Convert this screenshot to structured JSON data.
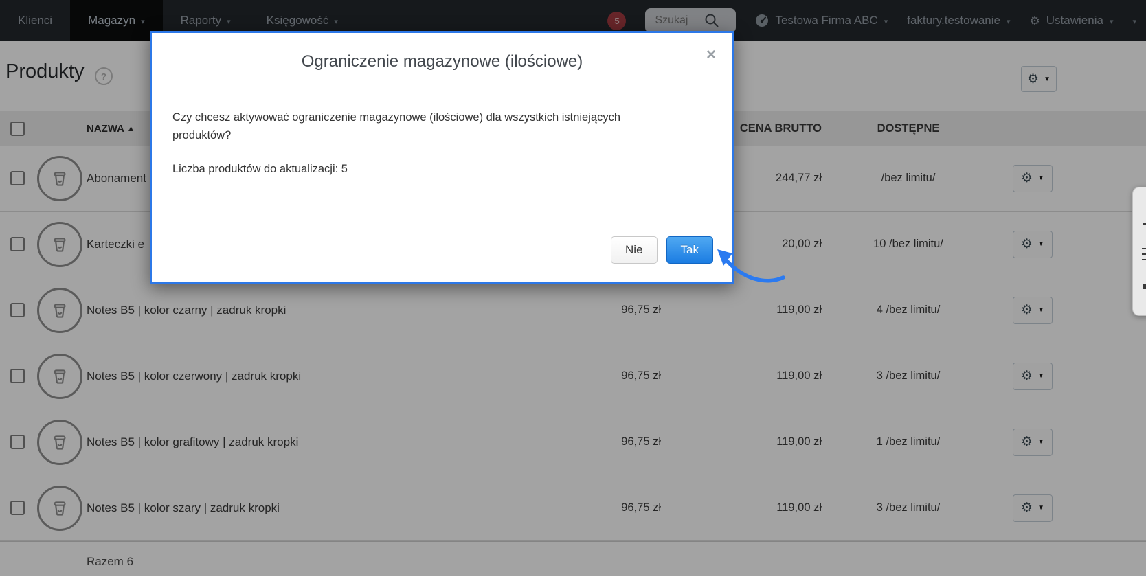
{
  "nav": {
    "items": [
      {
        "label": "Klienci",
        "caret": false
      },
      {
        "label": "Magazyn",
        "caret": true,
        "active": true
      },
      {
        "label": "Raporty",
        "caret": true
      },
      {
        "label": "Księgowość",
        "caret": true
      }
    ],
    "badge_count": "5",
    "search_placeholder": "Szukaj",
    "company": "Testowa Firma ABC",
    "account": "faktury.testowanie",
    "settings": "Ustawienia"
  },
  "icons": {
    "caret_down": "▾",
    "gear": "⚙",
    "sort_asc": "▲",
    "close": "×",
    "help": "?"
  },
  "page": {
    "title": "Produkty"
  },
  "table": {
    "headers": {
      "name": "NAZWA",
      "cena_brutto": "CENA BRUTTO",
      "dostepne": "DOSTĘPNE"
    },
    "rows": [
      {
        "name": "Abonament",
        "cena": "",
        "brutto": "244,77 zł",
        "dostepne": "/bez limitu/"
      },
      {
        "name": "Karteczki e",
        "cena": "",
        "brutto": "20,00 zł",
        "dostepne": "10 /bez limitu/"
      },
      {
        "name": "Notes B5 | kolor czarny | zadruk kropki",
        "cena": "96,75 zł",
        "brutto": "119,00 zł",
        "dostepne": "4 /bez limitu/"
      },
      {
        "name": "Notes B5 | kolor czerwony | zadruk kropki",
        "cena": "96,75 zł",
        "brutto": "119,00 zł",
        "dostepne": "3 /bez limitu/"
      },
      {
        "name": "Notes B5 | kolor grafitowy | zadruk kropki",
        "cena": "96,75 zł",
        "brutto": "119,00 zł",
        "dostepne": "1 /bez limitu/"
      },
      {
        "name": "Notes B5 | kolor szary | zadruk kropki",
        "cena": "96,75 zł",
        "brutto": "119,00 zł",
        "dostepne": "3 /bez limitu/"
      }
    ],
    "summary": "Razem 6"
  },
  "modal": {
    "title": "Ograniczenie magazynowe (ilościowe)",
    "body_line1": "Czy chcesz aktywować ograniczenie magazynowe (ilościowe) dla wszystkich istniejących produktów?",
    "body_line2": "Liczba produktów do aktualizacji: 5",
    "btn_no": "Nie",
    "btn_yes": "Tak"
  },
  "colors": {
    "accent_blue": "#2c78e8",
    "btn_yes_top": "#50a9f2",
    "btn_yes_bottom": "#1b7ce2",
    "badge_red": "#a23a40",
    "nav_bg": "#23282d"
  }
}
